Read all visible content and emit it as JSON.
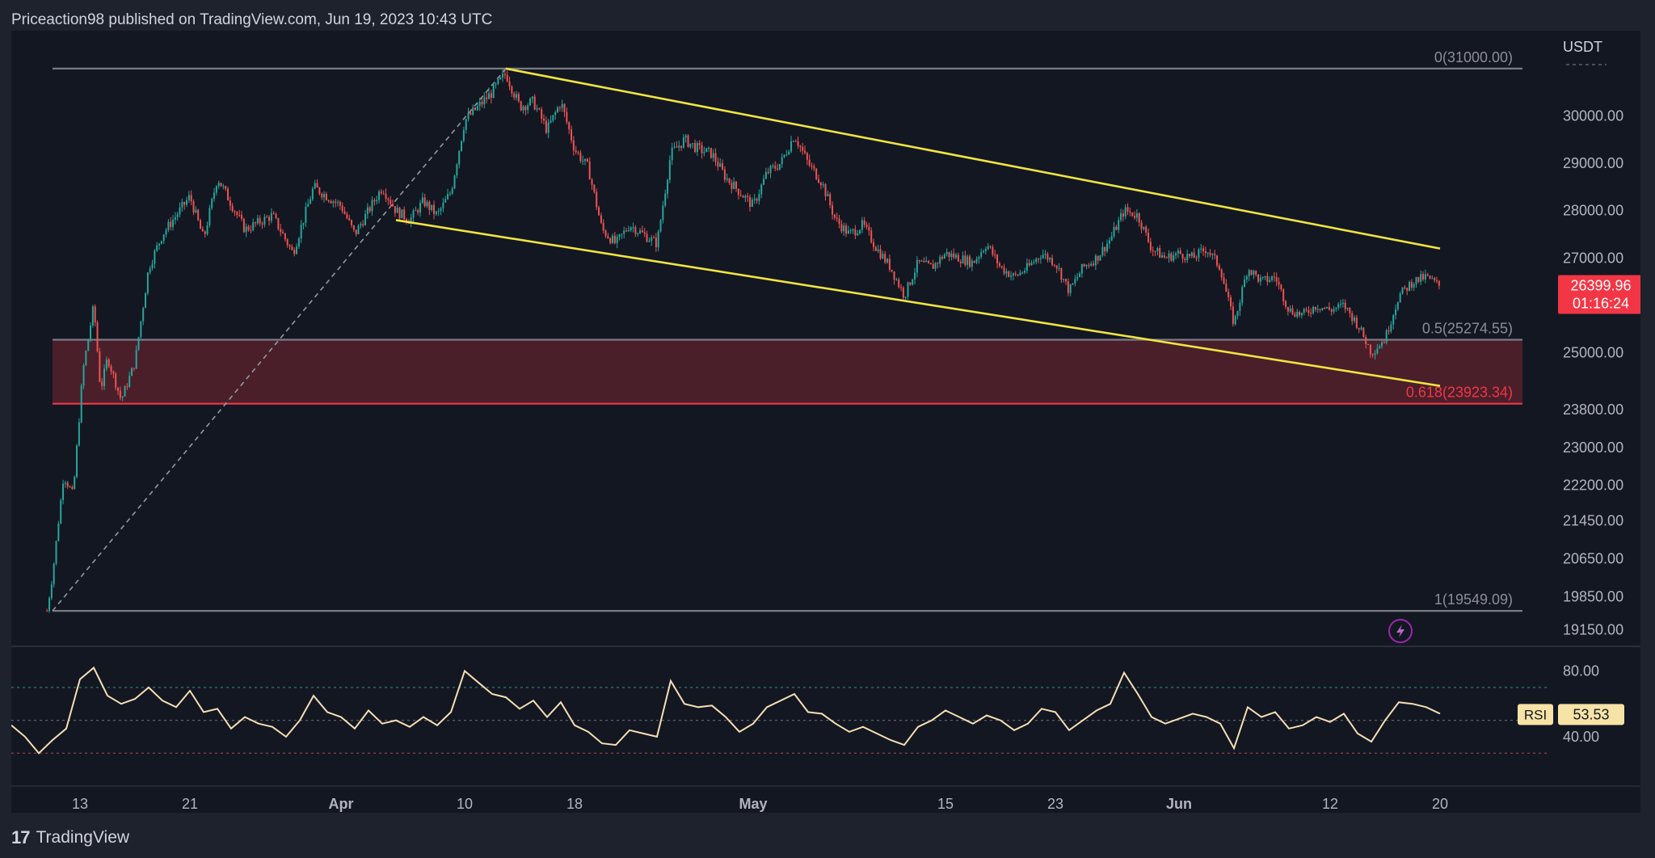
{
  "header": {
    "publisher_line": "Priceaction98 published on TradingView.com, Jun 19, 2023 10:43 UTC"
  },
  "footer": {
    "logo_glyph": "17",
    "brand": "TradingView"
  },
  "colors": {
    "background": "#131722",
    "frame": "#1e222d",
    "bull": "#26a69a",
    "bear": "#ef5350",
    "channel": "#f0e442",
    "fib_line": "#787b86",
    "fib_red": "#f23645",
    "zone_fill": "#4a1f2a",
    "rsi_line": "#f5deb3",
    "price_tag": "#f23645",
    "rsi_badge": "#f7e3a6",
    "text": "#b2b5be"
  },
  "chart_data": {
    "type": "candlestick",
    "symbol_currency": "USDT",
    "y_axis": {
      "min": 18800,
      "max": 31800,
      "ticks": [
        "30000.00",
        "29000.00",
        "28000.00",
        "27000.00",
        "25000.00",
        "23800.00",
        "23000.00",
        "22200.00",
        "21450.00",
        "20650.00",
        "19850.00",
        "19150.00"
      ],
      "tick_values": [
        30000,
        29000,
        28000,
        27000,
        25000,
        23800,
        23000,
        22200,
        21450,
        20650,
        19850,
        19150
      ]
    },
    "x_axis": {
      "labels": [
        "13",
        "21",
        "Apr",
        "10",
        "18",
        "May",
        "15",
        "23",
        "Jun",
        "12",
        "20"
      ],
      "label_days": [
        13,
        21,
        32,
        41,
        49,
        62,
        76,
        84,
        93,
        104,
        112
      ],
      "day_origin": "2023-03-01",
      "bold_labels": [
        "Apr",
        "May",
        "Jun"
      ]
    },
    "last_price": {
      "value": "26399.96",
      "countdown": "01:16:24"
    },
    "key_points": [
      {
        "day": 10.6,
        "price": 19549
      },
      {
        "day": 11,
        "price": 20300
      },
      {
        "day": 11.8,
        "price": 22400
      },
      {
        "day": 12.5,
        "price": 22000
      },
      {
        "day": 13.2,
        "price": 24600
      },
      {
        "day": 14,
        "price": 26000
      },
      {
        "day": 14.5,
        "price": 24200
      },
      {
        "day": 15,
        "price": 24900
      },
      {
        "day": 16,
        "price": 24000
      },
      {
        "day": 17,
        "price": 24800
      },
      {
        "day": 18,
        "price": 26800
      },
      {
        "day": 19,
        "price": 27500
      },
      {
        "day": 21,
        "price": 28300
      },
      {
        "day": 22,
        "price": 27400
      },
      {
        "day": 23,
        "price": 28700
      },
      {
        "day": 25,
        "price": 27600
      },
      {
        "day": 27,
        "price": 27900
      },
      {
        "day": 28.5,
        "price": 27100
      },
      {
        "day": 30,
        "price": 28500
      },
      {
        "day": 32,
        "price": 28100
      },
      {
        "day": 33,
        "price": 27500
      },
      {
        "day": 35,
        "price": 28500
      },
      {
        "day": 36,
        "price": 28000
      },
      {
        "day": 37,
        "price": 27800
      },
      {
        "day": 38,
        "price": 28200
      },
      {
        "day": 39,
        "price": 27900
      },
      {
        "day": 40,
        "price": 28400
      },
      {
        "day": 41,
        "price": 29900
      },
      {
        "day": 42,
        "price": 30200
      },
      {
        "day": 43,
        "price": 30500
      },
      {
        "day": 44,
        "price": 30900
      },
      {
        "day": 45,
        "price": 30200
      },
      {
        "day": 46,
        "price": 30300
      },
      {
        "day": 47,
        "price": 29700
      },
      {
        "day": 48,
        "price": 30300
      },
      {
        "day": 49,
        "price": 29300
      },
      {
        "day": 50,
        "price": 28900
      },
      {
        "day": 51,
        "price": 27600
      },
      {
        "day": 52,
        "price": 27300
      },
      {
        "day": 53,
        "price": 27700
      },
      {
        "day": 54,
        "price": 27500
      },
      {
        "day": 55,
        "price": 27300
      },
      {
        "day": 56,
        "price": 29200
      },
      {
        "day": 57,
        "price": 29500
      },
      {
        "day": 58,
        "price": 29300
      },
      {
        "day": 59,
        "price": 29200
      },
      {
        "day": 60,
        "price": 28700
      },
      {
        "day": 61,
        "price": 28400
      },
      {
        "day": 62,
        "price": 28100
      },
      {
        "day": 63,
        "price": 28800
      },
      {
        "day": 64,
        "price": 29000
      },
      {
        "day": 65,
        "price": 29600
      },
      {
        "day": 66,
        "price": 29000
      },
      {
        "day": 67,
        "price": 28600
      },
      {
        "day": 68,
        "price": 27800
      },
      {
        "day": 69,
        "price": 27500
      },
      {
        "day": 70,
        "price": 27700
      },
      {
        "day": 71,
        "price": 27200
      },
      {
        "day": 72,
        "price": 26800
      },
      {
        "day": 73,
        "price": 26200
      },
      {
        "day": 74,
        "price": 26900
      },
      {
        "day": 75,
        "price": 26800
      },
      {
        "day": 76,
        "price": 27100
      },
      {
        "day": 77,
        "price": 27000
      },
      {
        "day": 78,
        "price": 26900
      },
      {
        "day": 79,
        "price": 27300
      },
      {
        "day": 80,
        "price": 26800
      },
      {
        "day": 81,
        "price": 26600
      },
      {
        "day": 82,
        "price": 26800
      },
      {
        "day": 83,
        "price": 27100
      },
      {
        "day": 84,
        "price": 26900
      },
      {
        "day": 85,
        "price": 26300
      },
      {
        "day": 86,
        "price": 26800
      },
      {
        "day": 87,
        "price": 27000
      },
      {
        "day": 88,
        "price": 27400
      },
      {
        "day": 89,
        "price": 28000
      },
      {
        "day": 90,
        "price": 27900
      },
      {
        "day": 91,
        "price": 27200
      },
      {
        "day": 92,
        "price": 27000
      },
      {
        "day": 93,
        "price": 27100
      },
      {
        "day": 94,
        "price": 27000
      },
      {
        "day": 95,
        "price": 27200
      },
      {
        "day": 96,
        "price": 26800
      },
      {
        "day": 97,
        "price": 25600
      },
      {
        "day": 98,
        "price": 26800
      },
      {
        "day": 99,
        "price": 26500
      },
      {
        "day": 100,
        "price": 26600
      },
      {
        "day": 101,
        "price": 25900
      },
      {
        "day": 102,
        "price": 25800
      },
      {
        "day": 103,
        "price": 26000
      },
      {
        "day": 104,
        "price": 25900
      },
      {
        "day": 105,
        "price": 26000
      },
      {
        "day": 106,
        "price": 25600
      },
      {
        "day": 107,
        "price": 25000
      },
      {
        "day": 108,
        "price": 25300
      },
      {
        "day": 109,
        "price": 26200
      },
      {
        "day": 110,
        "price": 26500
      },
      {
        "day": 111,
        "price": 26600
      },
      {
        "day": 112,
        "price": 26400
      }
    ],
    "fib_levels": [
      {
        "label": "0(31000.00)",
        "price": 31000
      },
      {
        "label": "0.5(25274.55)",
        "price": 25274.55
      },
      {
        "label": "0.618(23923.34)",
        "price": 23923.34
      },
      {
        "label": "1(19549.09)",
        "price": 19549.09
      }
    ],
    "fib_range_days": [
      11,
      118
    ],
    "fib_diagonal": [
      {
        "day": 11,
        "price": 19549
      },
      {
        "day": 44,
        "price": 31000
      }
    ],
    "channel_lines": [
      [
        {
          "day": 44,
          "price": 31000
        },
        {
          "day": 112,
          "price": 27200
        }
      ],
      [
        {
          "day": 36,
          "price": 27800
        },
        {
          "day": 112,
          "price": 24300
        }
      ]
    ],
    "rsi": {
      "label": "RSI",
      "value": "53.53",
      "min": 10,
      "max": 95,
      "upper_band": 70,
      "lower_band": 30,
      "mid": 50,
      "ticks": [
        "80.00",
        "40.00"
      ],
      "tick_values": [
        80,
        40
      ],
      "points": [
        [
          8,
          47
        ],
        [
          9,
          40
        ],
        [
          10,
          30
        ],
        [
          11,
          38
        ],
        [
          12,
          45
        ],
        [
          13,
          75
        ],
        [
          14,
          82
        ],
        [
          15,
          65
        ],
        [
          16,
          60
        ],
        [
          17,
          63
        ],
        [
          18,
          70
        ],
        [
          19,
          62
        ],
        [
          20,
          58
        ],
        [
          21,
          68
        ],
        [
          22,
          55
        ],
        [
          23,
          57
        ],
        [
          24,
          45
        ],
        [
          25,
          52
        ],
        [
          26,
          48
        ],
        [
          27,
          46
        ],
        [
          28,
          40
        ],
        [
          29,
          50
        ],
        [
          30,
          65
        ],
        [
          31,
          55
        ],
        [
          32,
          52
        ],
        [
          33,
          45
        ],
        [
          34,
          56
        ],
        [
          35,
          48
        ],
        [
          36,
          50
        ],
        [
          37,
          46
        ],
        [
          38,
          52
        ],
        [
          39,
          47
        ],
        [
          40,
          55
        ],
        [
          41,
          80
        ],
        [
          42,
          73
        ],
        [
          43,
          66
        ],
        [
          44,
          64
        ],
        [
          45,
          57
        ],
        [
          46,
          62
        ],
        [
          47,
          52
        ],
        [
          48,
          61
        ],
        [
          49,
          47
        ],
        [
          50,
          43
        ],
        [
          51,
          36
        ],
        [
          52,
          35
        ],
        [
          53,
          44
        ],
        [
          54,
          42
        ],
        [
          55,
          40
        ],
        [
          56,
          74
        ],
        [
          57,
          60
        ],
        [
          58,
          58
        ],
        [
          59,
          59
        ],
        [
          60,
          52
        ],
        [
          61,
          43
        ],
        [
          62,
          48
        ],
        [
          63,
          58
        ],
        [
          64,
          62
        ],
        [
          65,
          66
        ],
        [
          66,
          55
        ],
        [
          67,
          54
        ],
        [
          68,
          48
        ],
        [
          69,
          43
        ],
        [
          70,
          46
        ],
        [
          71,
          42
        ],
        [
          72,
          38
        ],
        [
          73,
          35
        ],
        [
          74,
          46
        ],
        [
          75,
          50
        ],
        [
          76,
          56
        ],
        [
          77,
          52
        ],
        [
          78,
          48
        ],
        [
          79,
          53
        ],
        [
          80,
          50
        ],
        [
          81,
          44
        ],
        [
          82,
          48
        ],
        [
          83,
          57
        ],
        [
          84,
          55
        ],
        [
          85,
          44
        ],
        [
          86,
          50
        ],
        [
          87,
          56
        ],
        [
          88,
          60
        ],
        [
          89,
          79
        ],
        [
          90,
          66
        ],
        [
          91,
          52
        ],
        [
          92,
          48
        ],
        [
          93,
          51
        ],
        [
          94,
          54
        ],
        [
          95,
          52
        ],
        [
          96,
          48
        ],
        [
          97,
          33
        ],
        [
          98,
          58
        ],
        [
          99,
          52
        ],
        [
          100,
          55
        ],
        [
          101,
          45
        ],
        [
          102,
          47
        ],
        [
          103,
          52
        ],
        [
          104,
          49
        ],
        [
          105,
          54
        ],
        [
          106,
          42
        ],
        [
          107,
          37
        ],
        [
          108,
          50
        ],
        [
          109,
          61
        ],
        [
          110,
          60
        ],
        [
          111,
          58
        ],
        [
          112,
          54
        ]
      ]
    },
    "icons": [
      "lightning-icon"
    ]
  }
}
